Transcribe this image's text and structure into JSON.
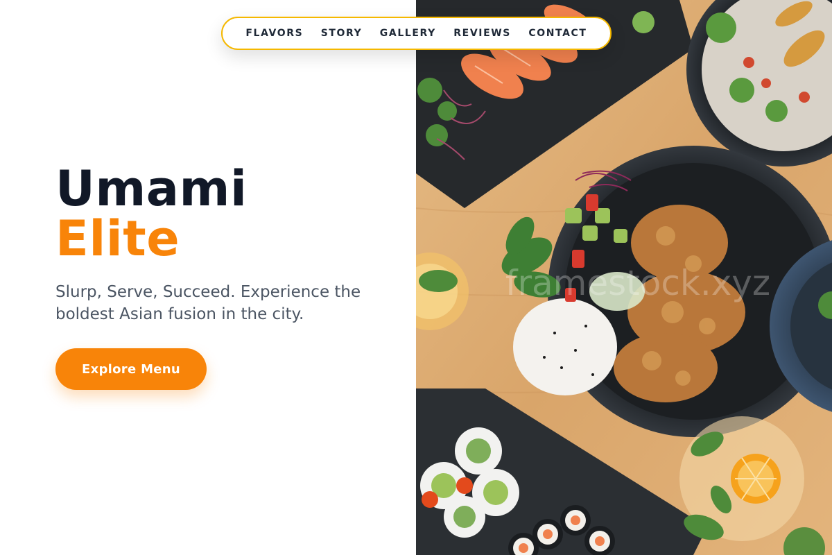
{
  "nav": {
    "items": [
      {
        "label": "FLAVORS"
      },
      {
        "label": "STORY"
      },
      {
        "label": "GALLERY"
      },
      {
        "label": "REVIEWS"
      },
      {
        "label": "CONTACT"
      }
    ]
  },
  "hero": {
    "title_line1": "Umami",
    "title_line2": "Elite",
    "tagline": "Slurp, Serve, Succeed. Experience the boldest Asian fusion in the city.",
    "cta_label": "Explore Menu",
    "photo_watermark": "framestock.xyz"
  },
  "colors": {
    "accent": "#F88409",
    "nav_border": "#F5B800",
    "title_dark": "#111827",
    "tagline": "#4B5563"
  }
}
